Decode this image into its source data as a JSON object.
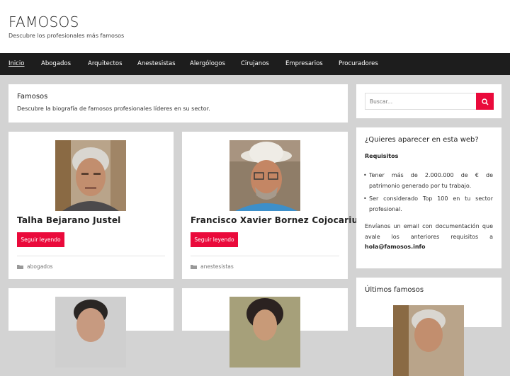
{
  "site": {
    "title": "FAMOSOS",
    "description": "Descubre los profesionales más famosos"
  },
  "nav": {
    "items": [
      {
        "label": "Inicio",
        "active": true
      },
      {
        "label": "Abogados"
      },
      {
        "label": "Arquitectos"
      },
      {
        "label": "Anestesistas"
      },
      {
        "label": "Alergólogos"
      },
      {
        "label": "Cirujanos"
      },
      {
        "label": "Empresarios"
      },
      {
        "label": "Procuradores"
      }
    ]
  },
  "intro": {
    "title": "Famosos",
    "text": "Descubre la biografía de famosos profesionales líderes en su sector."
  },
  "cards": [
    {
      "name": "Talha Bejarano Justel",
      "button": "Seguir leyendo",
      "category": "abogados"
    },
    {
      "name": "Francisco Xavier Bornez Cojocariu",
      "button": "Seguir leyendo",
      "category": "anestesistas"
    }
  ],
  "search": {
    "placeholder": "Buscar..."
  },
  "widget_join": {
    "title": "¿Quieres aparecer en esta web?",
    "subtitle": "Requisitos",
    "requirements": [
      "Tener más de 2.000.000 de € de patrimonio generado por tu trabajo.",
      "Ser considerado Top 100 en tu sector profesional."
    ],
    "paragraph": "Envíanos un email con documentación que avale los anteriores requisitos a",
    "email": "hola@famosos.info"
  },
  "widget_latest": {
    "title": "Últimos famosos"
  },
  "colors": {
    "accent": "#ea0a3b",
    "nav_bg": "#1d1d1d",
    "page_bg": "#d3d3d3"
  }
}
